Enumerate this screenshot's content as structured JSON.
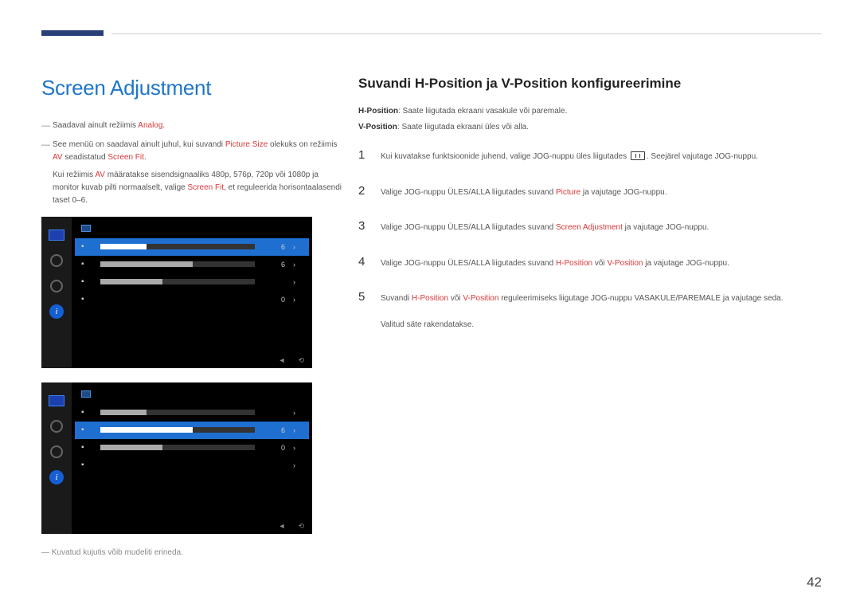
{
  "left": {
    "title": "Screen Adjustment",
    "bullet1": {
      "pre": "Saadaval ainult režiimis ",
      "red": "Analog",
      "post": "."
    },
    "bullet2": {
      "pre": "See menüü on saadaval ainult juhul, kui suvandi ",
      "red1": "Picture Size",
      "mid1": " olekuks on režiimis ",
      "red2": "AV",
      "mid2": " seadistatud ",
      "red3": "Screen Fit",
      "post": "."
    },
    "bullet2_sub": {
      "pre": "Kui režiimis ",
      "red1": "AV",
      "mid": " määratakse sisendsignaaliks 480p, 576p, 720p või 1080p ja monitor kuvab pilti normaalselt, valige ",
      "red2": "Screen Fit",
      "post": ", et reguleerida horisontaalasendi taset 0–6."
    },
    "foot": "Kuvatud kujutis võib mudeliti erineda."
  },
  "osd": {
    "rows": [
      {
        "val": "6",
        "fill": 30
      },
      {
        "val": "6",
        "fill": 60
      },
      {
        "val": "",
        "fill": 40
      },
      {
        "val": "0",
        "fill": 35,
        "nobar": true
      }
    ],
    "foot_left": "◄",
    "foot_right": "⟲"
  },
  "right": {
    "title": "Suvandi H-Position ja V-Position konfigureerimine",
    "def1": {
      "label": "H-Position",
      "text": ": Saate liigutada ekraani vasakule või paremale."
    },
    "def2": {
      "label": "V-Position",
      "text": ": Saate liigutada ekraani üles või alla."
    },
    "steps": {
      "s1": {
        "pre": "Kui kuvatakse funktsioonide juhend, valige JOG-nuppu üles liigutades ",
        "post": ". Seejärel vajutage JOG-nuppu."
      },
      "s2": {
        "pre": "Valige JOG-nuppu ÜLES/ALLA liigutades suvand ",
        "red": "Picture",
        "post": " ja vajutage JOG-nuppu."
      },
      "s3": {
        "pre": "Valige JOG-nuppu ÜLES/ALLA liigutades suvand ",
        "red": "Screen Adjustment",
        "post": " ja vajutage JOG-nuppu."
      },
      "s4": {
        "pre": "Valige JOG-nuppu ÜLES/ALLA liigutades suvand ",
        "red1": "H-Position",
        "mid": " või ",
        "red2": "V-Position",
        "post": " ja vajutage JOG-nuppu."
      },
      "s5": {
        "pre": "Suvandi ",
        "red1": "H-Position",
        "mid": " või ",
        "red2": "V-Position",
        "post": " reguleerimiseks liigutage JOG-nuppu VASAKULE/PAREMALE ja vajutage seda."
      },
      "final": "Valitud säte rakendatakse."
    }
  },
  "page": "42"
}
